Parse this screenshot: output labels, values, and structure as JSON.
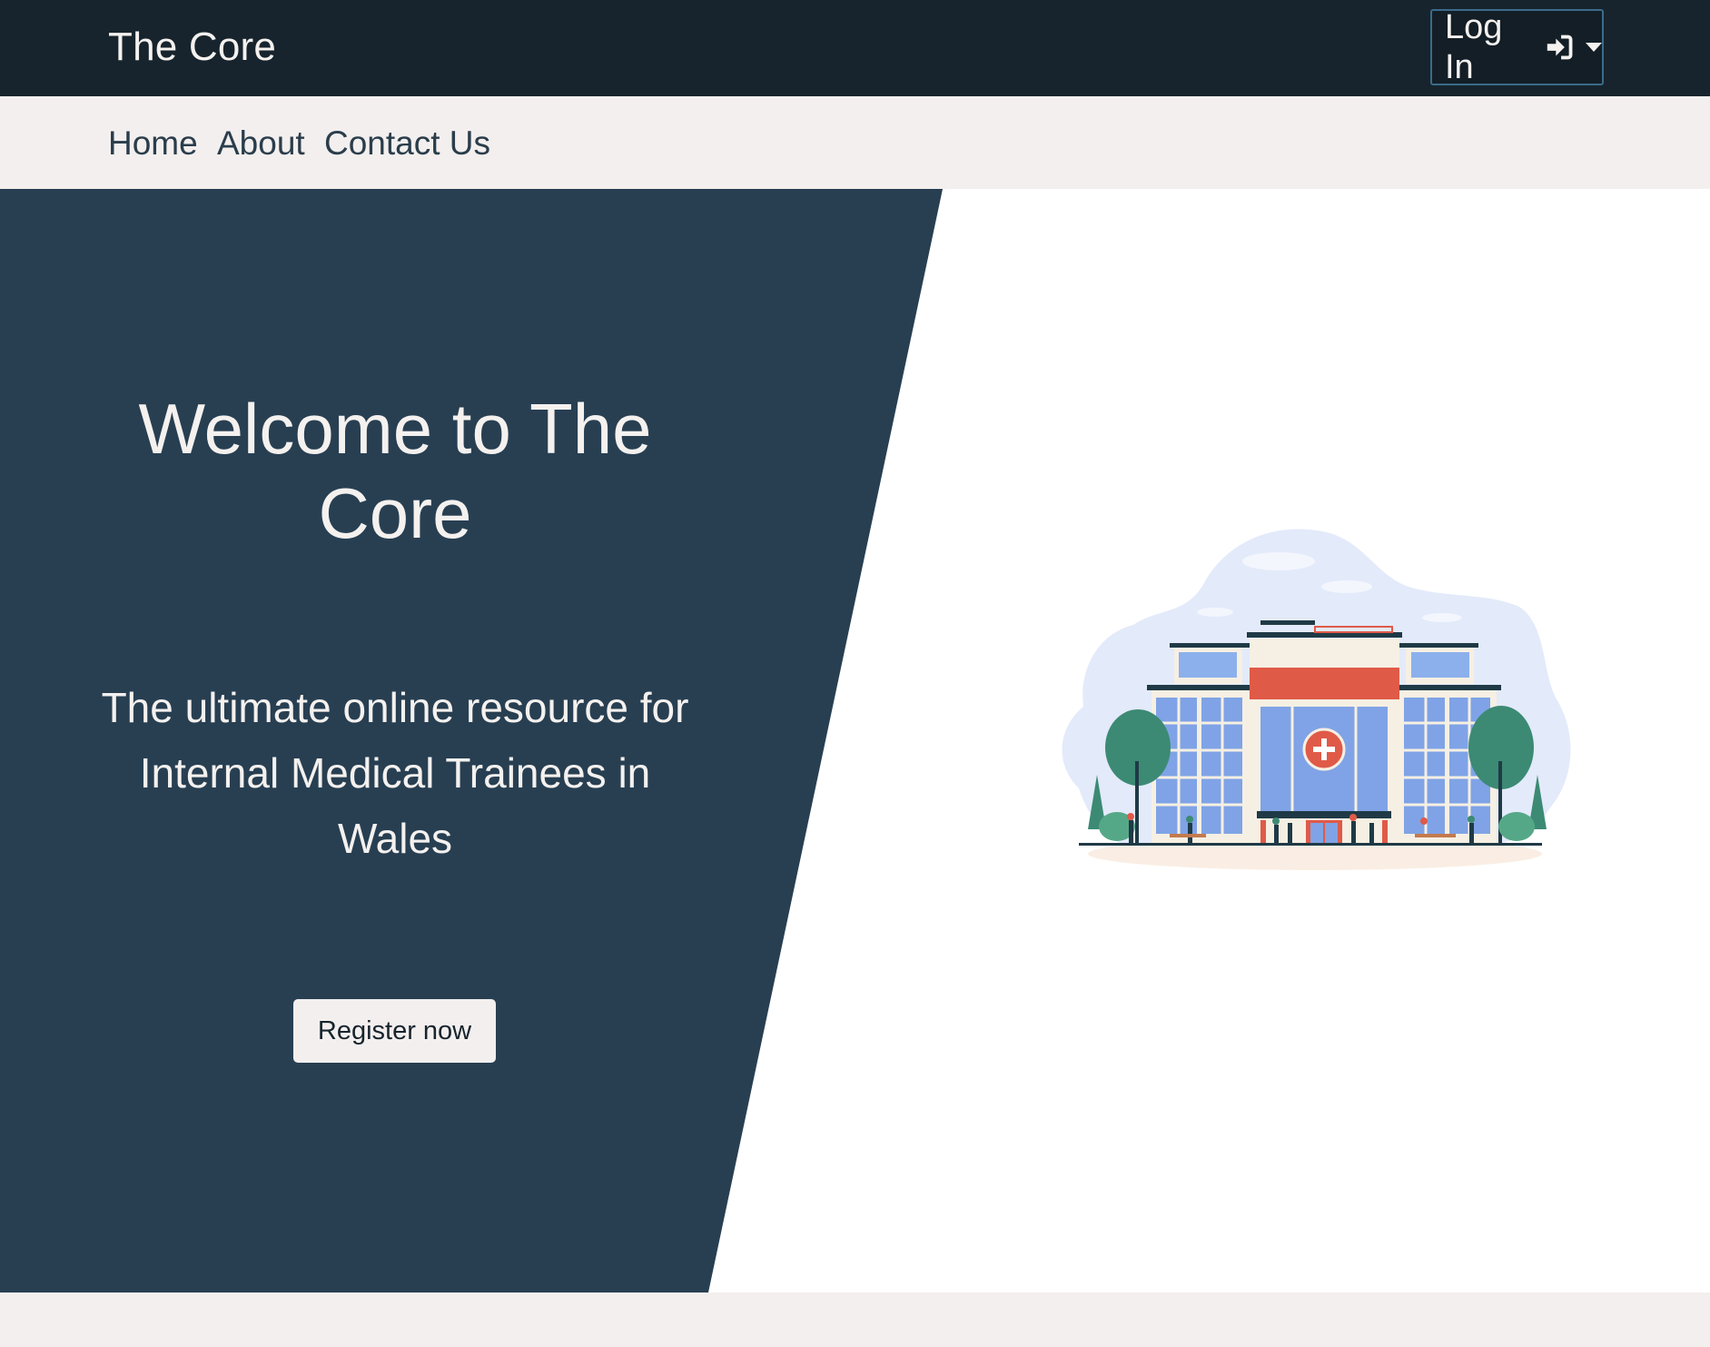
{
  "header": {
    "brand": "The Core",
    "login_label": "Log In",
    "login_icon": "sign-in-icon",
    "dropdown_icon": "caret-down-icon"
  },
  "nav": {
    "items": [
      {
        "label": "Home"
      },
      {
        "label": "About"
      },
      {
        "label": "Contact Us"
      }
    ]
  },
  "hero": {
    "title": "Welcome to The Core",
    "subtitle": "The ultimate online resource for Internal Medical Trainees in Wales",
    "register_label": "Register now",
    "illustration": "hospital-building-illustration"
  },
  "colors": {
    "topbar_bg": "#17242d",
    "hero_panel_bg": "#283f52",
    "nav_bg": "#f3efee",
    "text_light": "#f4f1ef",
    "accent_red": "#e05a48"
  }
}
